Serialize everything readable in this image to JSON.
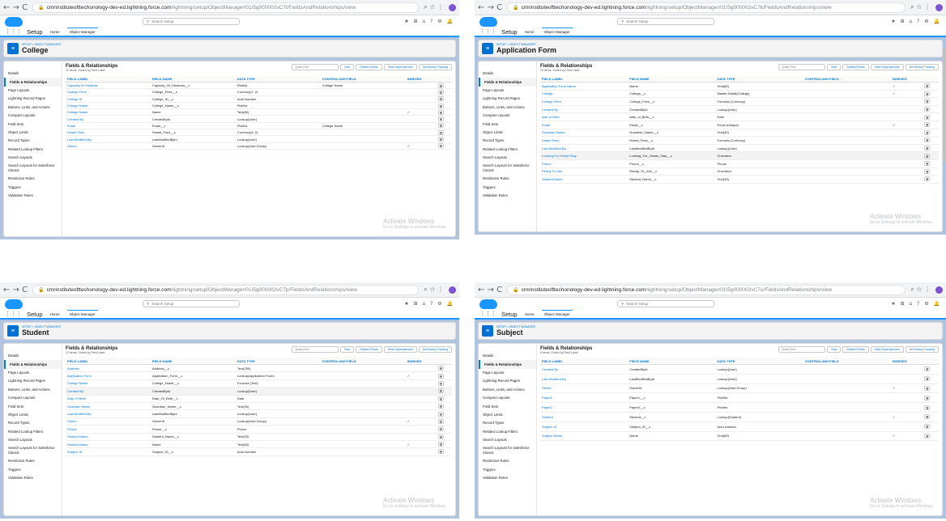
{
  "common": {
    "nav": "←  →  C",
    "search_placeholder": "Search Setup",
    "setup_label": "Setup",
    "tab_home": "Home",
    "tab_objmgr": "Object Manager",
    "breadcrumb": "SETUP > OBJECT MANAGER",
    "fr_title": "Fields & Relationships",
    "quick_find": "Quick Find",
    "btn_new": "New",
    "btn_deleted": "Deleted Fields",
    "btn_dependencies": "Field Dependencies",
    "btn_history": "Set History Tracking",
    "col_label": "FIELD LABEL",
    "col_name": "FIELD NAME",
    "col_type": "DATA TYPE",
    "col_controlling": "CONTROLLING FIELD",
    "col_indexed": "INDEXED",
    "watermark_1": "Activate Windows",
    "watermark_2": "Go to Settings to activate Windows.",
    "sidebar": [
      "Details",
      "Fields & Relationships",
      "Page Layouts",
      "Lightning Record Pages",
      "Buttons, Links, and Actions",
      "Compact Layouts",
      "Field Sets",
      "Object Limits",
      "Record Types",
      "Related Lookup Filters",
      "Search Layouts",
      "Search Layouts for Salesforce Classic",
      "Restriction Rules",
      "Triggers",
      "Validation Rules"
    ],
    "check_icon": "✓",
    "dropdown_icon": "▼"
  },
  "screens": [
    {
      "url_host": "cmrinstituteofttechonology-dev-ed.lightning.force.com",
      "url_path": "/lightning/setup/ObjectManager/01I5g000002vC7t/FieldsAndRelationships/view",
      "object_name": "College",
      "fr_sub": "10 Items, Sorted by Field Label",
      "rows": [
        {
          "label": "Capacity Of Students",
          "name": "Capacity_Of_Students__c",
          "type": "Picklist",
          "ctrl": "College Name",
          "idx": false
        },
        {
          "label": "College Fees",
          "name": "College_Fees__c",
          "type": "Currency(7, 2)",
          "ctrl": "",
          "idx": false
        },
        {
          "label": "College ID",
          "name": "College_ID__c",
          "type": "Auto Number",
          "ctrl": "",
          "idx": false
        },
        {
          "label": "College Name",
          "name": "College_Name__c",
          "type": "Picklist",
          "ctrl": "",
          "idx": false
        },
        {
          "label": "College Name",
          "name": "Name",
          "type": "Text(80)",
          "ctrl": "",
          "idx": true
        },
        {
          "label": "Created By",
          "name": "CreatedById",
          "type": "Lookup(User)",
          "ctrl": "",
          "idx": false
        },
        {
          "label": "Email",
          "name": "Email__c",
          "type": "Picklist",
          "ctrl": "College Name",
          "idx": false
        },
        {
          "label": "Hostel Fees",
          "name": "Hostel_Fees__c",
          "type": "Currency(5, 2)",
          "ctrl": "",
          "idx": false
        },
        {
          "label": "Last Modified By",
          "name": "LastModifiedById",
          "type": "Lookup(User)",
          "ctrl": "",
          "idx": false
        },
        {
          "label": "Owner",
          "name": "OwnerId",
          "type": "Lookup(User,Group)",
          "ctrl": "",
          "idx": true
        }
      ]
    },
    {
      "url_host": "cmrinstituteofttechonology-dev-ed.lightning.force.com",
      "url_path": "/lightning/setup/ObjectManager/01I5g000002vC7k/FieldsAndRelationships/view",
      "object_name": "Application Form",
      "fr_sub": "15 Items, Sorted by Field Label",
      "rows": [
        {
          "label": "Application Form Name",
          "name": "Name",
          "type": "Text(80)",
          "ctrl": "",
          "idx": true
        },
        {
          "label": "College",
          "name": "College__c",
          "type": "Master-Detail(College)",
          "ctrl": "",
          "idx": true
        },
        {
          "label": "College Fees",
          "name": "College_Fees__c",
          "type": "Formula (Currency)",
          "ctrl": "",
          "idx": false
        },
        {
          "label": "Created By",
          "name": "CreatedById",
          "type": "Lookup(User)",
          "ctrl": "",
          "idx": false
        },
        {
          "label": "date of Birth",
          "name": "date_of_Birth__c",
          "type": "Date",
          "ctrl": "",
          "idx": false
        },
        {
          "label": "Email",
          "name": "Email__c",
          "type": "Email (Unique)",
          "ctrl": "",
          "idx": true
        },
        {
          "label": "Guardian Name",
          "name": "Guardian_Name__c",
          "type": "Text(30)",
          "ctrl": "",
          "idx": false
        },
        {
          "label": "Hostel Fees",
          "name": "Hostel_Fees__c",
          "type": "Formula (Currency)",
          "ctrl": "",
          "idx": false
        },
        {
          "label": "Last Modified By",
          "name": "LastModifiedById",
          "type": "Lookup(User)",
          "ctrl": "",
          "idx": false
        },
        {
          "label": "Looking For Hostel Stay",
          "name": "Looking_For_Hostel_Stay__c",
          "type": "Checkbox",
          "ctrl": "",
          "idx": false
        },
        {
          "label": "Phone",
          "name": "Phone__c",
          "type": "Phone",
          "ctrl": "",
          "idx": false
        },
        {
          "label": "Ready To Join",
          "name": "Ready_To_Join__c",
          "type": "Checkbox",
          "ctrl": "",
          "idx": false
        },
        {
          "label": "Student Name",
          "name": "Student_Name__c",
          "type": "Text(30)",
          "ctrl": "",
          "idx": false
        }
      ]
    },
    {
      "url_host": "cmrinstituteofttechonology-dev-ed.lightning.force.com",
      "url_path": "/lightning/setup/ObjectManager/01I5g000002vC7p/FieldsAndRelationships/view",
      "object_name": "Student",
      "fr_sub": "12 Items, Sorted by Field Label",
      "rows": [
        {
          "label": "Address",
          "name": "Address__c",
          "type": "Text(255)",
          "ctrl": "",
          "idx": false
        },
        {
          "label": "Application Form",
          "name": "Application_Form__c",
          "type": "Lookup(Application Form)",
          "ctrl": "",
          "idx": true
        },
        {
          "label": "College Name",
          "name": "College_Name__c",
          "type": "Formula (Text)",
          "ctrl": "",
          "idx": false
        },
        {
          "label": "Created By",
          "name": "CreatedById",
          "type": "Lookup(User)",
          "ctrl": "",
          "idx": false
        },
        {
          "label": "Date Of Birth",
          "name": "Date_Of_Birth__c",
          "type": "Date",
          "ctrl": "",
          "idx": false
        },
        {
          "label": "Guardian Name",
          "name": "Guardian_Name__c",
          "type": "Text(30)",
          "ctrl": "",
          "idx": false
        },
        {
          "label": "Last Modified By",
          "name": "LastModifiedById",
          "type": "Lookup(User)",
          "ctrl": "",
          "idx": false
        },
        {
          "label": "Owner",
          "name": "OwnerId",
          "type": "Lookup(User,Group)",
          "ctrl": "",
          "idx": true
        },
        {
          "label": "Phone",
          "name": "Phone__c",
          "type": "Phone",
          "ctrl": "",
          "idx": false
        },
        {
          "label": "Student Name",
          "name": "Student_Name__c",
          "type": "Text(30)",
          "ctrl": "",
          "idx": false
        },
        {
          "label": "Student Name",
          "name": "Name",
          "type": "Text(80)",
          "ctrl": "",
          "idx": true
        },
        {
          "label": "Subject ID",
          "name": "Subject_ID__c",
          "type": "Auto Number",
          "ctrl": "",
          "idx": false
        }
      ]
    },
    {
      "url_host": "cmrinstituteofttechonology-dev-ed.lightning.force.com",
      "url_path": "/lightning/setup/ObjectManager/01I5g000002vC7u/FieldsAndRelationships/view",
      "object_name": "Subject",
      "fr_sub": "8 Items, Sorted by Field Label",
      "rows": [
        {
          "label": "Created By",
          "name": "CreatedById",
          "type": "Lookup(User)",
          "ctrl": "",
          "idx": false
        },
        {
          "label": "Last Modified By",
          "name": "LastModifiedById",
          "type": "Lookup(User)",
          "ctrl": "",
          "idx": false
        },
        {
          "label": "Owner",
          "name": "OwnerId",
          "type": "Lookup(User,Group)",
          "ctrl": "",
          "idx": true
        },
        {
          "label": "Paper1",
          "name": "Paper1__c",
          "type": "Picklist",
          "ctrl": "",
          "idx": false
        },
        {
          "label": "Paper2",
          "name": "Paper2__c",
          "type": "Picklist",
          "ctrl": "",
          "idx": false
        },
        {
          "label": "Student",
          "name": "Student__c",
          "type": "Lookup(Student)",
          "ctrl": "",
          "idx": true
        },
        {
          "label": "Subject ID",
          "name": "Subject_ID__c",
          "type": "Auto Number",
          "ctrl": "",
          "idx": false
        },
        {
          "label": "Subject Name",
          "name": "Name",
          "type": "Text(80)",
          "ctrl": "",
          "idx": true
        }
      ]
    }
  ]
}
